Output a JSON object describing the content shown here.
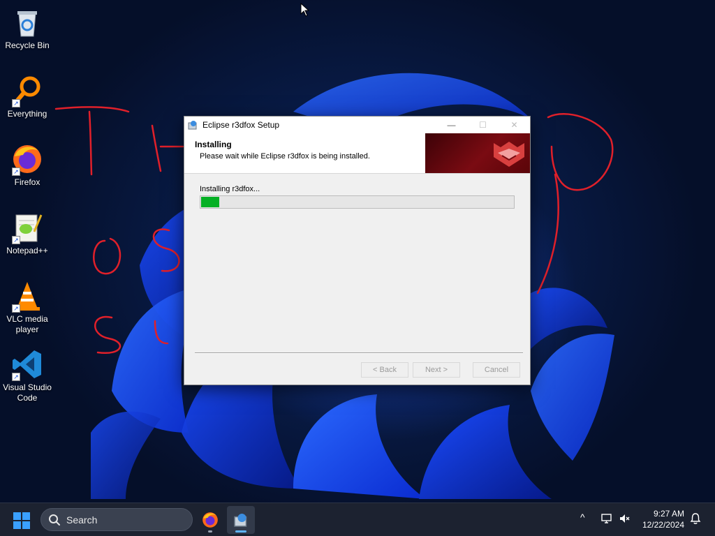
{
  "desktop": {
    "icons": [
      {
        "label": "Recycle Bin",
        "icon": "recycle-bin-icon"
      },
      {
        "label": "Everything",
        "icon": "everything-search-icon"
      },
      {
        "label": "Firefox",
        "icon": "firefox-icon"
      },
      {
        "label": "Notepad++",
        "icon": "notepad-plus-plus-icon"
      },
      {
        "label": "VLC media player",
        "icon": "vlc-icon"
      },
      {
        "label": "Visual Studio Code",
        "icon": "vscode-icon"
      }
    ],
    "annotation_color": "#e0202a",
    "annotation_text": "THE OS SU..."
  },
  "setup": {
    "title": "Eclipse r3dfox Setup",
    "header_title": "Installing",
    "header_subtitle": "Please wait while Eclipse r3dfox is being installed.",
    "status": "Installing r3dfox...",
    "progress_fraction": 0.06,
    "progress_color": "#06b025",
    "buttons": {
      "back": "< Back",
      "next": "Next >",
      "cancel": "Cancel"
    },
    "window_controls": {
      "minimize": "—",
      "maximize": "☐",
      "close": "✕"
    }
  },
  "taskbar": {
    "search_placeholder": "Search",
    "apps": [
      {
        "name": "Firefox",
        "icon": "firefox-icon"
      },
      {
        "name": "Eclipse r3dfox Setup",
        "icon": "installer-icon"
      }
    ],
    "tray_chevron": "^",
    "time": "9:27 AM",
    "date": "12/22/2024"
  }
}
